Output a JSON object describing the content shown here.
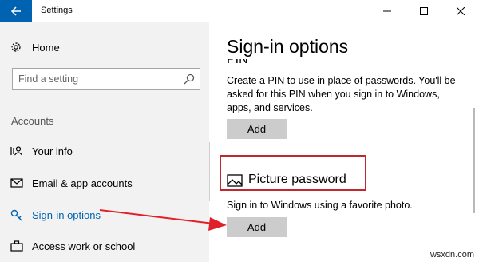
{
  "window": {
    "title": "Settings",
    "back_icon": "back-arrow-icon",
    "controls": [
      "minimize-icon",
      "maximize-icon",
      "close-icon"
    ]
  },
  "sidebar": {
    "home_label": "Home",
    "search_placeholder": "Find a setting",
    "section_label": "Accounts",
    "items": [
      {
        "label": "Your info",
        "icon": "person-card-icon"
      },
      {
        "label": "Email & app accounts",
        "icon": "email-icon"
      },
      {
        "label": "Sign-in options",
        "icon": "key-icon",
        "active": true
      },
      {
        "label": "Access work or school",
        "icon": "briefcase-icon"
      }
    ]
  },
  "main": {
    "page_title": "Sign-in options",
    "pin_heading_clipped": "PIN",
    "pin_description": "Create a PIN to use in place of passwords. You'll be asked for this PIN when you sign in to Windows, apps, and services.",
    "pin_add_label": "Add",
    "picture_password_heading": "Picture password",
    "picture_password_description": "Sign in to Windows using a favorite photo.",
    "picture_password_add_label": "Add"
  },
  "colors": {
    "accent": "#0063b1",
    "annotation_red": "#c0282d",
    "sidebar_bg": "#f2f2f2",
    "button_bg": "#cccccc"
  },
  "watermark": "wsxdn.com"
}
